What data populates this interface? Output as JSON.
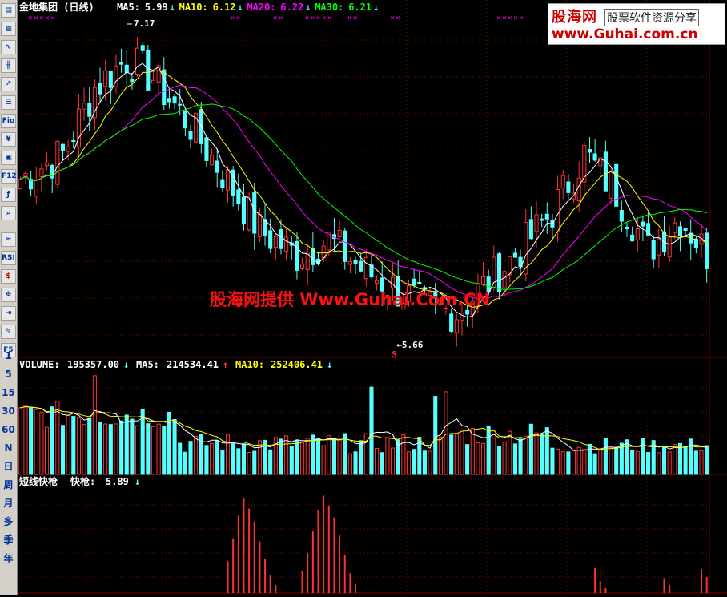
{
  "main_header": {
    "title": "金地集团 (日线)",
    "items": [
      {
        "label": "MA5:",
        "value": "5.99",
        "arrow": "↓",
        "color": "#ffffff"
      },
      {
        "label": "MA10:",
        "value": "6.12",
        "arrow": "↓",
        "color": "#ffff00"
      },
      {
        "label": "MA20:",
        "value": "6.22",
        "arrow": "↓",
        "color": "#ff00ff"
      },
      {
        "label": "MA30:",
        "value": "6.21",
        "arrow": "↓",
        "color": "#00ff00"
      }
    ]
  },
  "volume_header": {
    "label": "VOLUME:",
    "value": "195357.00",
    "arrow": "↓",
    "ma5_label": "MA5:",
    "ma5_value": "214534.41",
    "ma5_arrow": "↑",
    "ma10_label": "MA10:",
    "ma10_value": "252406.41",
    "ma10_arrow": "↓"
  },
  "indicator_header": {
    "label": "短线快枪",
    "sub_label": "快枪:",
    "value": "5.89",
    "arrow": "↓"
  },
  "annotations": {
    "high": "7.17",
    "low": "←5.66",
    "signal": "S"
  },
  "logo": {
    "name": "股海网",
    "slogan": "股票软件资源分享",
    "url": "www.Guhai.com.cn"
  },
  "watermark": "股海网提供 Www.Guhai.Com.CN",
  "toolbar": {
    "icons": [
      "table-icon",
      "grid-icon",
      "line-icon",
      "candle-icon",
      "trend-icon",
      "news-icon",
      "f10-icon",
      "finance-icon",
      "report-icon",
      "f12-icon",
      "formula-icon",
      "search-icon",
      "indicator-icon",
      "rsi-icon",
      "dollar-icon",
      "move-icon",
      "export-icon",
      "pencil-icon",
      "f5-icon"
    ],
    "labels": [
      "Fio",
      "F12",
      "RSI",
      "F5"
    ],
    "periods": [
      "1",
      "5",
      "15",
      "30",
      "60",
      "N",
      "日",
      "周",
      "月",
      "多",
      "季",
      "年"
    ]
  },
  "colors": {
    "up": "#ff3232",
    "down": "#54ffff",
    "ma5": "#ffffff",
    "ma10": "#ffff00",
    "ma20": "#ff00ff",
    "ma30": "#00ff00",
    "grid": "#800000"
  },
  "chart_data": {
    "type": "candlestick",
    "n": 130,
    "price_range": [
      5.5,
      7.25
    ],
    "key_closes": [
      [
        0,
        6.42
      ],
      [
        8,
        6.55
      ],
      [
        14,
        6.9
      ],
      [
        20,
        7.05
      ],
      [
        25,
        6.95
      ],
      [
        32,
        6.7
      ],
      [
        38,
        6.45
      ],
      [
        45,
        6.15
      ],
      [
        52,
        6.02
      ],
      [
        58,
        6.1
      ],
      [
        64,
        5.95
      ],
      [
        70,
        5.85
      ],
      [
        76,
        5.75
      ],
      [
        82,
        5.72
      ],
      [
        88,
        5.88
      ],
      [
        94,
        6.05
      ],
      [
        100,
        6.25
      ],
      [
        106,
        6.55
      ],
      [
        112,
        6.35
      ],
      [
        118,
        6.05
      ],
      [
        124,
        6.22
      ],
      [
        130,
        5.99
      ]
    ],
    "volume_range": [
      0,
      440000
    ],
    "ma5_volume": 214534.41,
    "ma10_volume": 252406.41,
    "last_volume": 195357.0,
    "volume_spikes": [
      [
        14,
        430000
      ],
      [
        66,
        380000
      ],
      [
        80,
        360000
      ],
      [
        78,
        340000
      ]
    ],
    "indicator_bars": [
      [
        39,
        0.32
      ],
      [
        40,
        0.55
      ],
      [
        41,
        0.78
      ],
      [
        42,
        0.95
      ],
      [
        43,
        0.85
      ],
      [
        44,
        0.72
      ],
      [
        45,
        0.52
      ],
      [
        46,
        0.34
      ],
      [
        47,
        0.18
      ],
      [
        48,
        0.08
      ],
      [
        53,
        0.22
      ],
      [
        54,
        0.4
      ],
      [
        55,
        0.62
      ],
      [
        56,
        0.84
      ],
      [
        57,
        0.98
      ],
      [
        58,
        0.88
      ],
      [
        59,
        0.76
      ],
      [
        60,
        0.58
      ],
      [
        61,
        0.38
      ],
      [
        62,
        0.2
      ],
      [
        63,
        0.09
      ],
      [
        108,
        0.25
      ],
      [
        109,
        0.12
      ],
      [
        110,
        0.05
      ],
      [
        121,
        0.15
      ],
      [
        122,
        0.08
      ],
      [
        128,
        0.24
      ],
      [
        129,
        0.16
      ]
    ]
  }
}
